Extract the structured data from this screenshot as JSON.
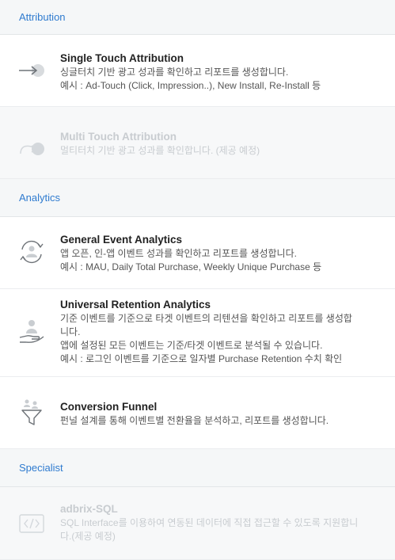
{
  "sections": {
    "attribution": {
      "header": "Attribution",
      "items": [
        {
          "title": "Single Touch Attribution",
          "desc1": "싱글터치 기반 광고 성과를 확인하고 리포트를 생성합니다.",
          "desc2": "예시 : Ad-Touch (Click, Impression..), New Install, Re-Install 등",
          "icon": "single-touch-arrow-icon",
          "enabled": true
        },
        {
          "title": "Multi Touch Attribution",
          "desc1": "멀티터치 기반 광고 성과를 확인합니다. (제공 예정)",
          "icon": "multi-touch-arrow-icon",
          "enabled": false
        }
      ]
    },
    "analytics": {
      "header": "Analytics",
      "items": [
        {
          "title": "General Event Analytics",
          "desc1": "앱 오픈, 인-앱 이벤트 성과를 확인하고 리포트를 생성합니다.",
          "desc2": "예시 : MAU, Daily Total Purchase, Weekly Unique Purchase 등",
          "icon": "user-refresh-icon",
          "enabled": true
        },
        {
          "title": "Universal Retention Analytics",
          "desc1": "기준 이벤트를 기준으로 타겟 이벤트의 리텐션을 확인하고 리포트를 생성합",
          "desc2": "니다.",
          "desc3": "앱에 설정된 모든 이벤트는 기준/타겟 이벤트로 분석될 수 있습니다.",
          "desc4": "예시 : 로그인 이벤트를 기준으로 일자별 Purchase Retention 수치 확인",
          "icon": "user-hand-icon",
          "enabled": true
        },
        {
          "title": "Conversion Funnel",
          "desc1": "펀널 설계를 통해 이벤트별 전환율을 분석하고, 리포트를 생성합니다.",
          "icon": "funnel-icon",
          "enabled": true
        }
      ]
    },
    "specialist": {
      "header": "Specialist",
      "items": [
        {
          "title": "adbrix-SQL",
          "desc1": "SQL Interface를 이용하여 연동된 데이터에 직접 접근할 수 있도록 지원합니",
          "desc2": "다.(제공 예정)",
          "icon": "code-icon",
          "enabled": false
        }
      ]
    }
  },
  "colors": {
    "section_header": "#2f7bcf",
    "icon": "#8a8f94",
    "disabled_text": "#c8ccd0"
  }
}
